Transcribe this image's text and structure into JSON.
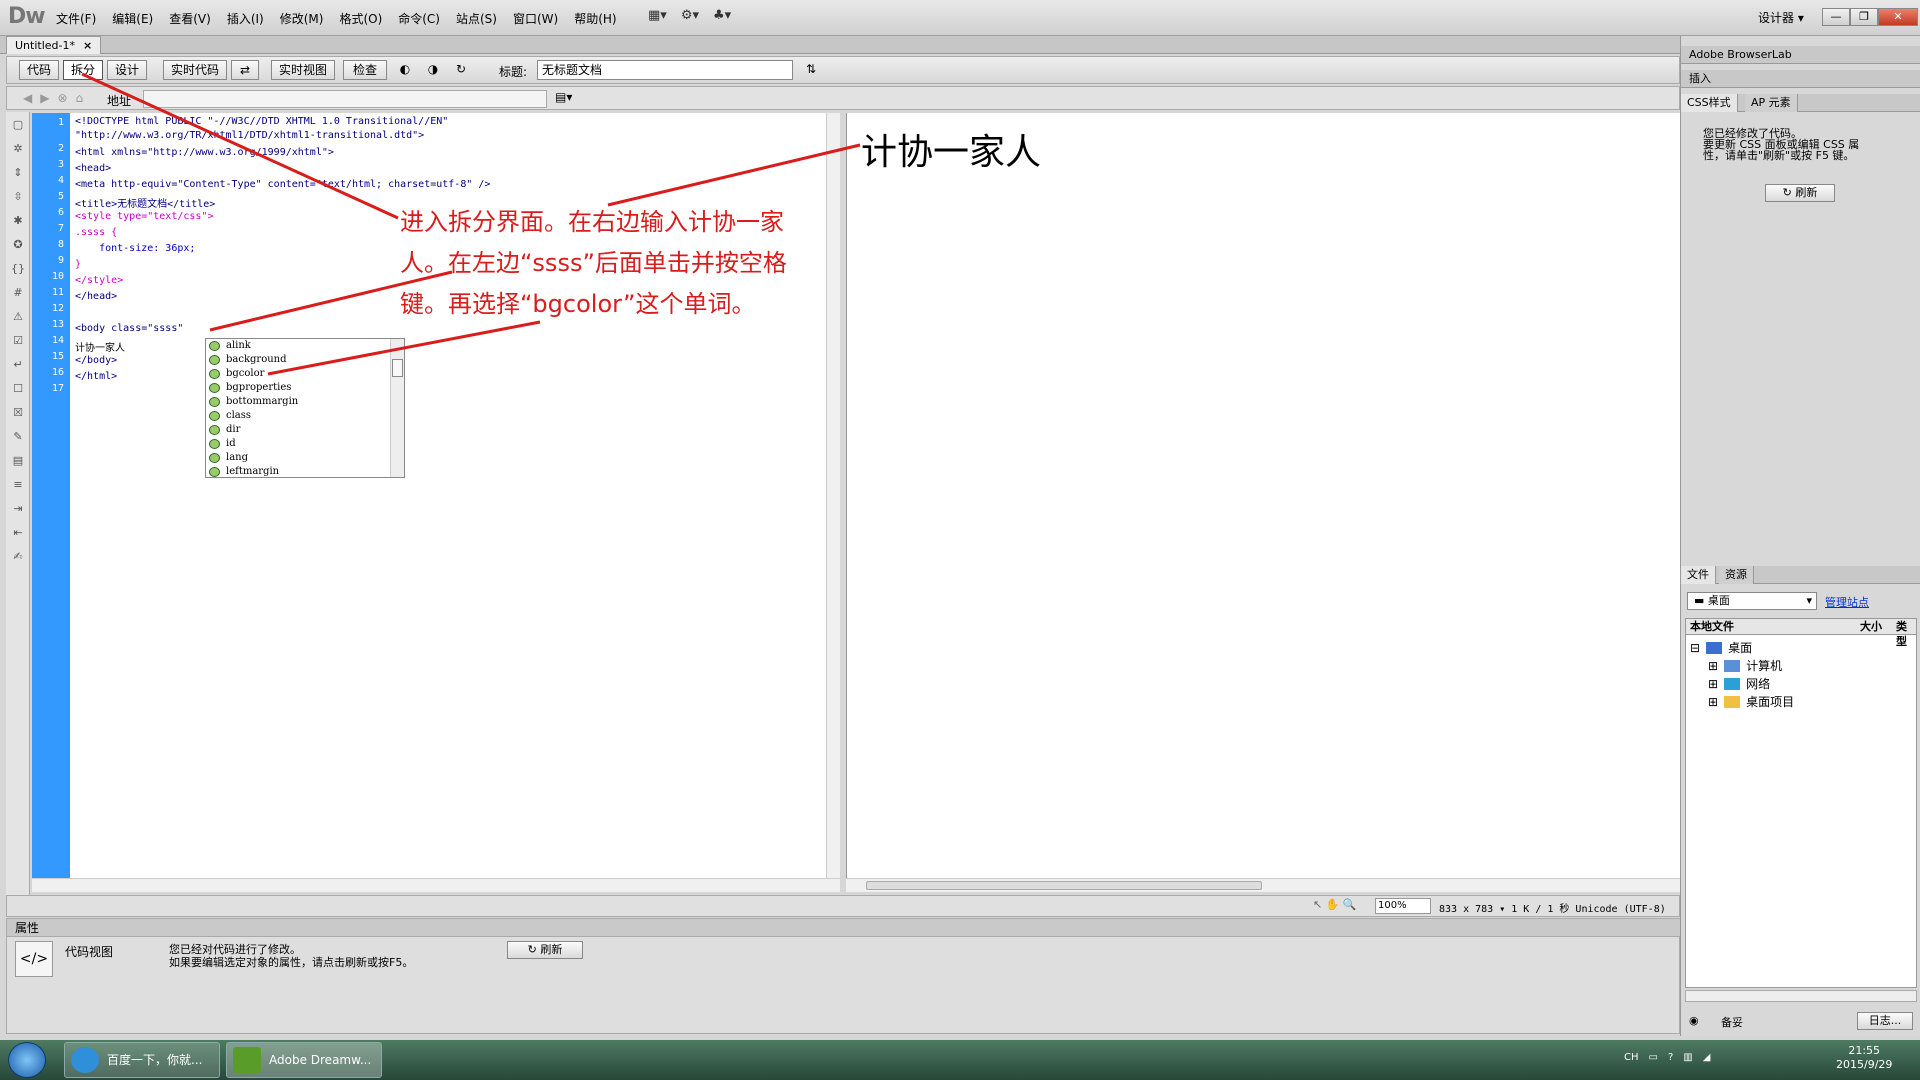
{
  "app": {
    "logo": "Dw"
  },
  "menu": [
    "文件(F)",
    "编辑(E)",
    "查看(V)",
    "插入(I)",
    "修改(M)",
    "格式(O)",
    "命令(C)",
    "站点(S)",
    "窗口(W)",
    "帮助(H)"
  ],
  "workspace_mode": "设计器 ▾",
  "window_controls": {
    "min": "—",
    "max": "❐",
    "close": "✕"
  },
  "doc_tab": {
    "label": "Untitled-1*",
    "close": "×"
  },
  "toolbar": {
    "code": "代码",
    "split": "拆分",
    "design": "设计",
    "live_code": "实时代码",
    "live_view": "实时视图",
    "inspect": "检查",
    "title_label": "标题:",
    "title_value": "无标题文档"
  },
  "addr": {
    "label": "地址"
  },
  "code_lines": {
    "numbers": [
      "1",
      "2",
      "3",
      "4",
      "5",
      "6",
      "7",
      "8",
      "9",
      "10",
      "11",
      "12",
      "13",
      "14",
      "15",
      "16",
      "17"
    ],
    "l1": "<!DOCTYPE html PUBLIC \"-//W3C//DTD XHTML 1.0 Transitional//EN\"",
    "l1b": "\"http://www.w3.org/TR/xhtml1/DTD/xhtml1-transitional.dtd\">",
    "l2": "<html xmlns=\"http://www.w3.org/1999/xhtml\">",
    "l3": "<head>",
    "l4": "<meta http-equiv=\"Content-Type\" content=\"text/html; charset=utf-8\" />",
    "l5": "<title>无标题文档</title>",
    "l6": "<style type=\"text/css\">",
    "l7": ".ssss {",
    "l8": "    font-size: 36px;",
    "l9": "}",
    "l10": "</style>",
    "l11": "</head>",
    "l13": "<body class=\"ssss\" ",
    "l14": "计协一家人",
    "l15": "</body>",
    "l16": "</html>"
  },
  "autocomplete": [
    "alink",
    "background",
    "bgcolor",
    "bgproperties",
    "bottommargin",
    "class",
    "dir",
    "id",
    "lang",
    "leftmargin"
  ],
  "design_text": "计协一家人",
  "annotation": "进入拆分界面。在右边输入计协一家人。在左边“ssss”后面单击并按空格键。再选择“bgcolor”这个单词。",
  "status": {
    "zoom": "100%",
    "dims": "833 x 783 ▾  1 K / 1 秒  Unicode (UTF-8)"
  },
  "properties": {
    "title": "属性",
    "view": "代码视图",
    "msg1": "您已经对代码进行了修改。",
    "msg2": "如果要编辑选定对象的属性，请点击刷新或按F5。",
    "refresh": "刷新"
  },
  "right_panel": {
    "browserlab": "Adobe BrowserLab",
    "insert": "插入",
    "css_tab": "CSS样式",
    "ap_tab": "AP 元素",
    "css_msg1": "您已经修改了代码。",
    "css_msg2": "要更新 CSS 面板或编辑 CSS 属",
    "css_msg3": "性，请单击\"刷新\"或按 F5 键。",
    "css_refresh": "刷新",
    "files_tab": "文件",
    "assets_tab": "资源",
    "site_select": "桌面",
    "manage_sites": "管理站点",
    "col_local": "本地文件",
    "col_size": "大小",
    "col_type": "类型",
    "tree": [
      "桌面",
      "计算机",
      "网络",
      "桌面项目"
    ],
    "backup_btn": "备妥",
    "log_btn": "日志..."
  },
  "taskbar": {
    "task1": "百度一下，你就...",
    "task2": "Adobe Dreamw...",
    "tray_lang": "CH",
    "time": "21:55",
    "date": "2015/9/29"
  }
}
